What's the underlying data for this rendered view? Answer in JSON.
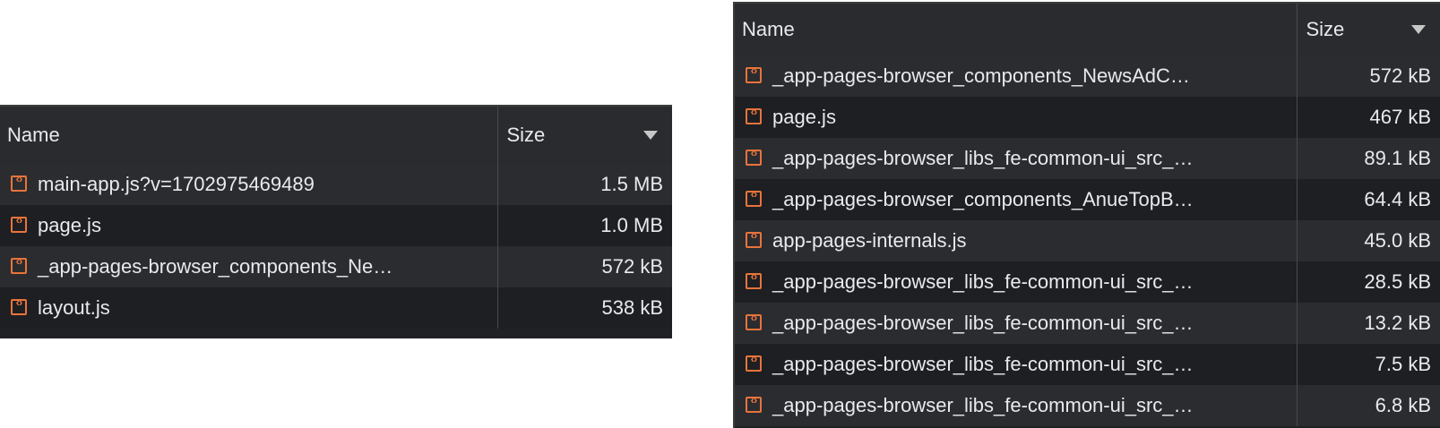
{
  "left_panel": {
    "columns": {
      "name": "Name",
      "size": "Size"
    },
    "rows": [
      {
        "name": "main-app.js?v=1702975469489",
        "size": "1.5 MB"
      },
      {
        "name": "page.js",
        "size": "1.0 MB"
      },
      {
        "name": "_app-pages-browser_components_Ne…",
        "size": "572 kB"
      },
      {
        "name": "layout.js",
        "size": "538 kB"
      }
    ]
  },
  "right_panel": {
    "columns": {
      "name": "Name",
      "size": "Size"
    },
    "rows": [
      {
        "name": "_app-pages-browser_components_NewsAdC…",
        "size": "572 kB"
      },
      {
        "name": "page.js",
        "size": "467 kB"
      },
      {
        "name": "_app-pages-browser_libs_fe-common-ui_src_…",
        "size": "89.1 kB"
      },
      {
        "name": "_app-pages-browser_components_AnueTopB…",
        "size": "64.4 kB"
      },
      {
        "name": "app-pages-internals.js",
        "size": "45.0 kB"
      },
      {
        "name": "_app-pages-browser_libs_fe-common-ui_src_…",
        "size": "28.5 kB"
      },
      {
        "name": "_app-pages-browser_libs_fe-common-ui_src_…",
        "size": "13.2 kB"
      },
      {
        "name": "_app-pages-browser_libs_fe-common-ui_src_…",
        "size": "7.5 kB"
      },
      {
        "name": "_app-pages-browser_libs_fe-common-ui_src_…",
        "size": "6.8 kB"
      }
    ]
  },
  "icon": "script-file-icon",
  "accent_color": "#e8743b",
  "sort": {
    "column": "Size",
    "direction": "descending"
  }
}
